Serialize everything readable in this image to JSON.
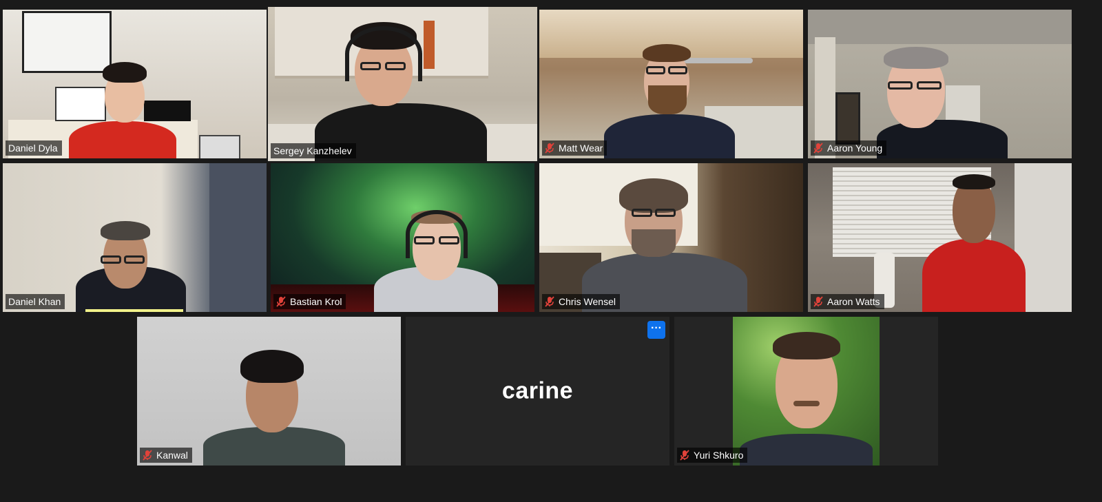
{
  "meeting": {
    "participants": [
      {
        "name": "Daniel Dyla",
        "muted": false
      },
      {
        "name": "Sergey Kanzhelev",
        "muted": false,
        "active_speaker": true
      },
      {
        "name": "Matt Wear",
        "muted": true
      },
      {
        "name": "Aaron Young",
        "muted": true
      },
      {
        "name": "Daniel Khan",
        "muted": false
      },
      {
        "name": "Bastian Krol",
        "muted": true
      },
      {
        "name": "Chris Wensel",
        "muted": true
      },
      {
        "name": "Aaron Watts",
        "muted": true
      },
      {
        "name": "Kanwal",
        "muted": true
      },
      {
        "name": "carine",
        "video_off": true
      },
      {
        "name": "Yuri Shkuro",
        "muted": true
      }
    ],
    "more_button_label": "···",
    "placeholder_name": "carine"
  },
  "colors": {
    "background": "#1a1a1a",
    "active_speaker_border": "#d9ef7a",
    "muted_icon": "#e0423a",
    "more_button": "#0e72ed"
  },
  "icons": {
    "muted": "microphone-muted-icon",
    "more": "more-options-icon"
  }
}
